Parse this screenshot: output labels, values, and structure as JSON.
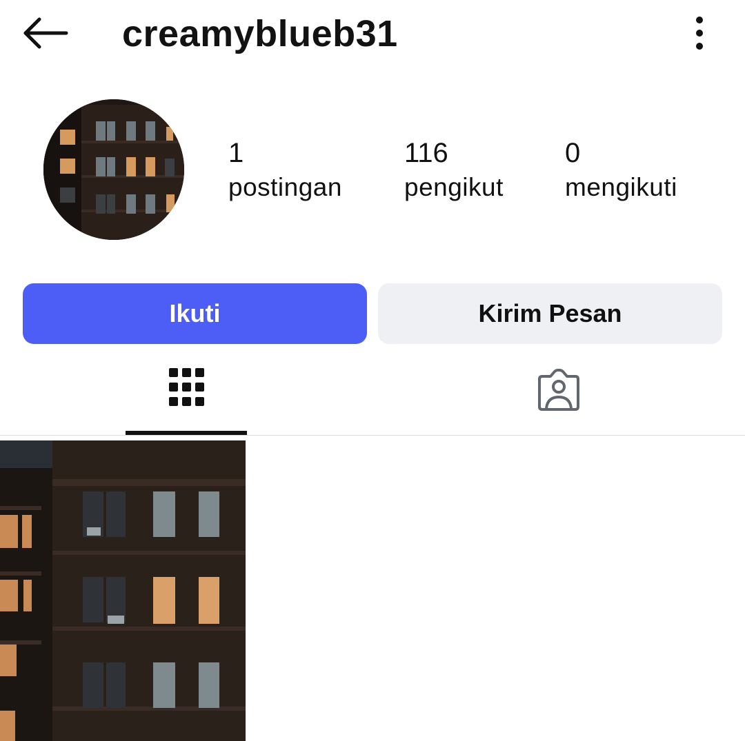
{
  "header": {
    "username": "creamyblueb31",
    "back_icon": "arrow-left-icon",
    "more_icon": "vertical-dots-icon"
  },
  "profile": {
    "stats": {
      "posts": {
        "count": "1",
        "label": "postingan"
      },
      "followers": {
        "count": "116",
        "label": "pengikut"
      },
      "following": {
        "count": "0",
        "label": "mengikuti"
      }
    }
  },
  "actions": {
    "follow_label": "Ikuti",
    "message_label": "Kirim Pesan"
  },
  "tabs": [
    {
      "icon": "grid-icon",
      "active": true
    },
    {
      "icon": "tagged-person-icon",
      "active": false
    }
  ],
  "colors": {
    "accent": "#4d5ef6",
    "secondary_button": "#eff0f4",
    "text": "#111111"
  }
}
